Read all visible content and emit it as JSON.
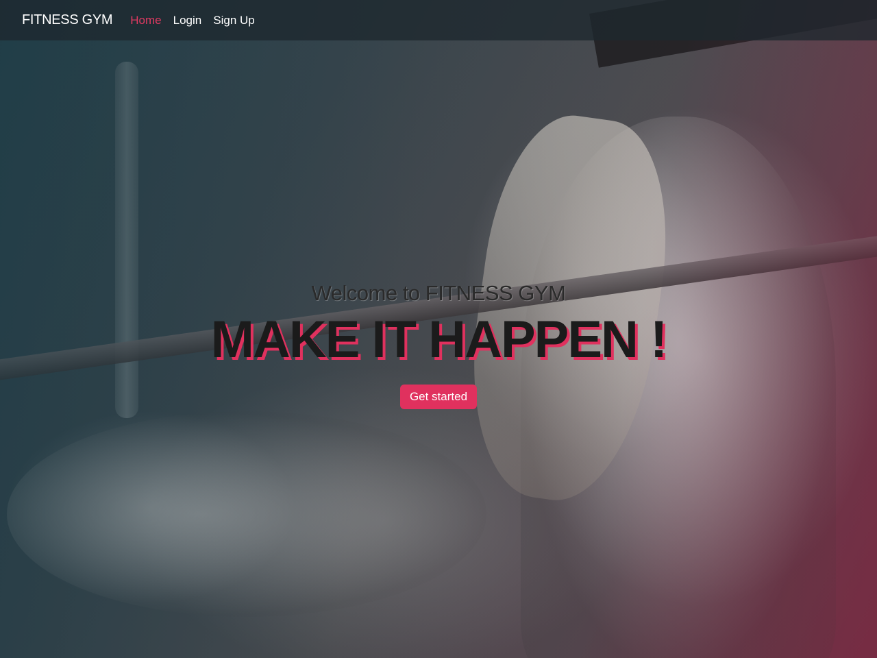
{
  "navbar": {
    "brand": "FITNESS GYM",
    "links": [
      {
        "label": "Home",
        "active": true
      },
      {
        "label": "Login",
        "active": false
      },
      {
        "label": "Sign Up",
        "active": false
      }
    ]
  },
  "hero": {
    "welcome": "Welcome to FITNESS GYM",
    "headline": "MAKE IT HAPPEN !",
    "cta_label": "Get started"
  },
  "colors": {
    "accent": "#e0315e",
    "nav_background": "#1e282e",
    "text_dark": "#1b1b1b"
  }
}
